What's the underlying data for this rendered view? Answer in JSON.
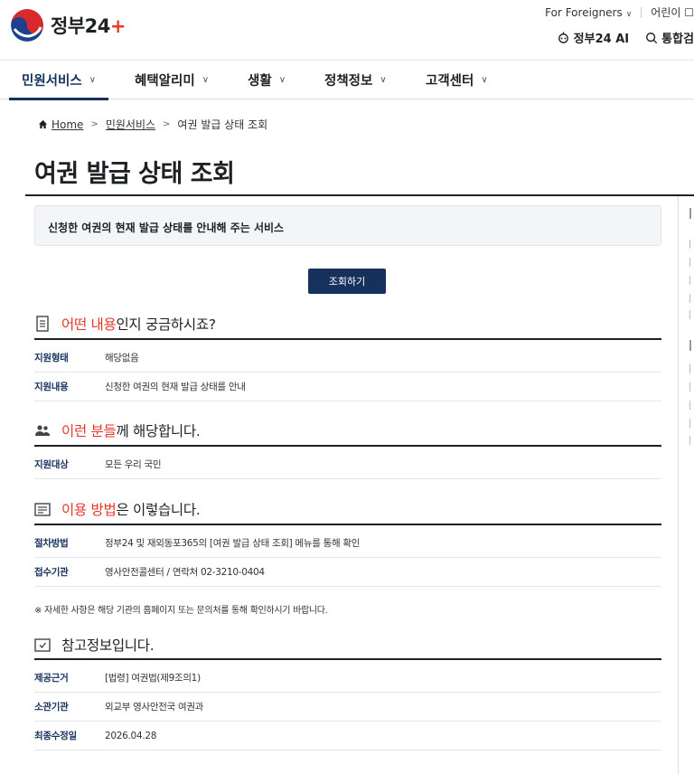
{
  "header": {
    "logo_text": "정부",
    "logo_num": "24",
    "for_foreigners": "For Foreigners",
    "kids": "어린이 ☐",
    "ai_label": "정부24 AI",
    "search_label": "통합검"
  },
  "gnb": {
    "items": [
      {
        "label": "민원서비스"
      },
      {
        "label": "혜택알리미"
      },
      {
        "label": "생활"
      },
      {
        "label": "정책정보"
      },
      {
        "label": "고객센터"
      }
    ]
  },
  "breadcrumb": {
    "home": "Home",
    "level1": "민원서비스",
    "current": "여권 발급 상태 조회"
  },
  "page": {
    "title": "여권 발급 상태 조회",
    "summary": "신청한 여권의 현재 발급 상태를 안내해 주는 서비스",
    "lookup_button": "조회하기"
  },
  "sections": {
    "what": {
      "highlight": "어떤 내용",
      "rest": "인지 궁금하시죠?",
      "rows": [
        {
          "k": "지원형태",
          "v": "해당없음"
        },
        {
          "k": "지원내용",
          "v": "신청한 여권의 현재 발급 상태를 안내"
        }
      ]
    },
    "who": {
      "highlight": "이런 분들",
      "rest": "께 해당합니다.",
      "rows": [
        {
          "k": "지원대상",
          "v": "모든 우리 국민"
        }
      ]
    },
    "how": {
      "highlight": "이용 방법",
      "rest": "은 이렇습니다.",
      "rows": [
        {
          "k": "절차방법",
          "v": "정부24 및 재외동포365의 [여권 발급 상태 조회] 메뉴를 통해 확인"
        },
        {
          "k": "접수기관",
          "v": "영사안전콜센터 / 연락처 02-3210-0404"
        }
      ],
      "note": "※ 자세한 사항은 해당 기관의 홈페이지 또는 문의처를 통해 확인하시기 바랍니다."
    },
    "ref": {
      "title": "참고정보입니다.",
      "rows": [
        {
          "k": "제공근거",
          "v": "[법령] 여권법(제9조의1)"
        },
        {
          "k": "소관기관",
          "v": "외교부 영사안전국 여권과"
        },
        {
          "k": "최종수정일",
          "v": "2026.04.28"
        }
      ]
    }
  },
  "colors": {
    "primary": "#16325c",
    "highlight": "#e6352b"
  }
}
